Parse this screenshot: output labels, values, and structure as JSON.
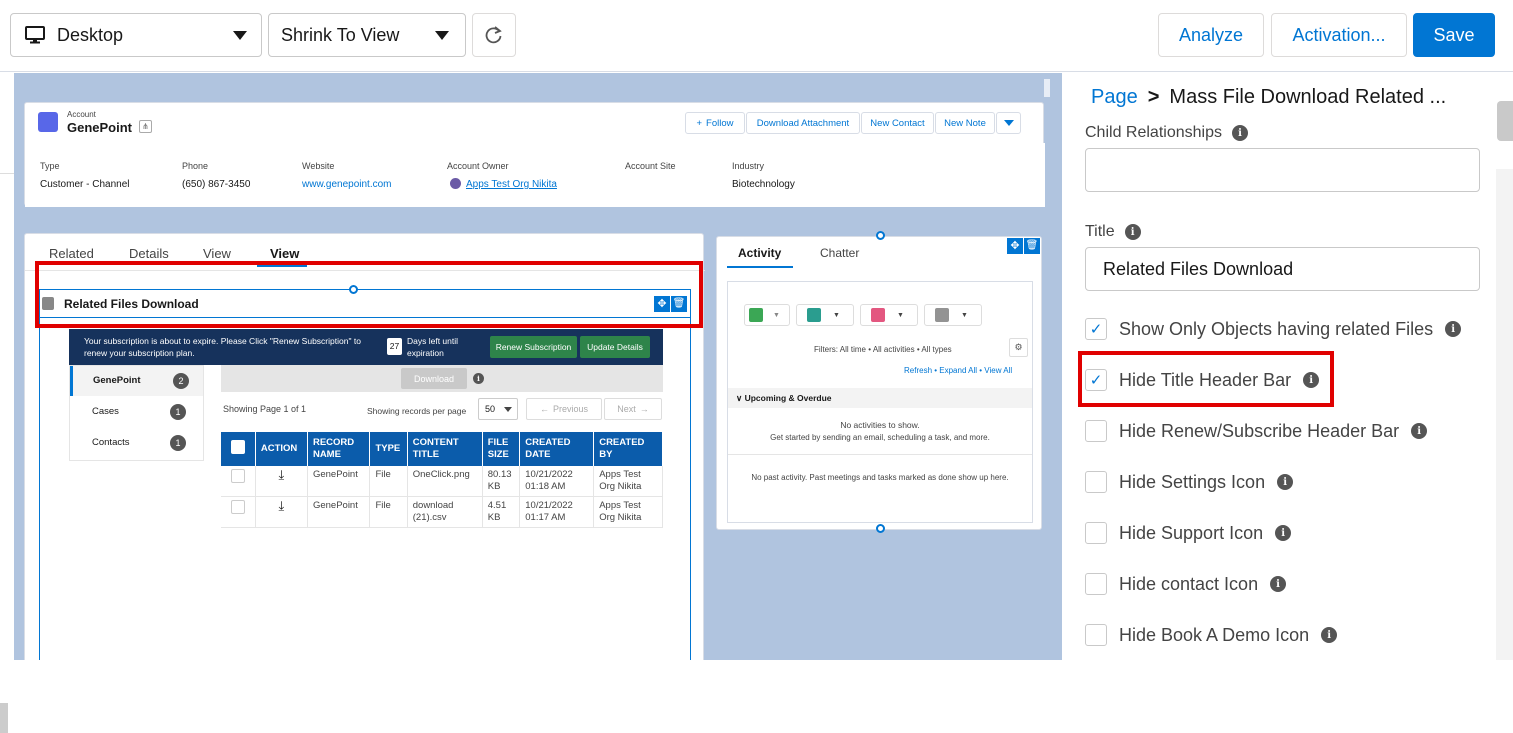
{
  "toolbar": {
    "device_label": "Desktop",
    "view_label": "Shrink To View",
    "analyze": "Analyze",
    "activation": "Activation...",
    "save": "Save"
  },
  "account": {
    "object_label": "Account",
    "name": "GenePoint",
    "buttons": [
      "Follow",
      "Download Attachment",
      "New Contact",
      "New Note"
    ],
    "fields": [
      {
        "label": "Type",
        "value": "Customer - Channel"
      },
      {
        "label": "Phone",
        "value": "(650) 867-3450"
      },
      {
        "label": "Website",
        "value": "www.genepoint.com"
      },
      {
        "label": "Account Owner",
        "value": "Apps Test Org Nikita"
      },
      {
        "label": "Account Site",
        "value": ""
      },
      {
        "label": "Industry",
        "value": "Biotechnology"
      }
    ]
  },
  "tabs": [
    "Related",
    "Details",
    "View",
    "View"
  ],
  "component": {
    "title": "Related Files Download",
    "banner_text": "Your subscription is about to expire. Please Click \"Renew Subscription\" to renew your subscription plan.",
    "days_left": "27",
    "days_text": "Days left until expiration",
    "renew_btn": "Renew Subscription",
    "update_btn": "Update Details",
    "objects": [
      {
        "name": "GenePoint",
        "count": "2"
      },
      {
        "name": "Cases",
        "count": "1"
      },
      {
        "name": "Contacts",
        "count": "1"
      }
    ],
    "download_btn": "Download",
    "showing_page": "Showing Page 1 of 1",
    "per_page_label": "Showing records per page",
    "per_page_value": "50",
    "prev": "Previous",
    "next": "Next",
    "columns": [
      "ACTION",
      "RECORD NAME",
      "TYPE",
      "CONTENT TITLE",
      "FILE SIZE",
      "CREATED DATE",
      "CREATED BY"
    ],
    "rows": [
      {
        "record": "GenePoint",
        "type": "File",
        "title": "OneClick.png",
        "size": "80.13 KB",
        "date": "10/21/2022 01:18 AM",
        "by": "Apps Test Org Nikita"
      },
      {
        "record": "GenePoint",
        "type": "File",
        "title": "download (21).csv",
        "size": "4.51 KB",
        "date": "10/21/2022 01:17 AM",
        "by": "Apps Test Org Nikita"
      }
    ]
  },
  "activity": {
    "tab_activity": "Activity",
    "tab_chatter": "Chatter",
    "filters": "Filters: All time • All activities • All types",
    "links": "Refresh • Expand All • View All",
    "upcoming": "Upcoming & Overdue",
    "no_act": "No activities to show.",
    "get_started": "Get started by sending an email, scheduling a task, and more.",
    "no_past": "No past activity. Past meetings and tasks marked as done show up here."
  },
  "panel": {
    "breadcrumb_page": "Page",
    "breadcrumb_sep": ">",
    "breadcrumb_current": "Mass File Download Related ...",
    "child_rel_label": "Child Relationships",
    "child_rel_value": "",
    "title_label": "Title",
    "title_value": "Related Files Download",
    "options": [
      {
        "label": "Show Only Objects having related Files",
        "checked": true
      },
      {
        "label": "Hide Title Header Bar",
        "checked": true
      },
      {
        "label": "Hide Renew/Subscribe Header Bar",
        "checked": false
      },
      {
        "label": "Hide Settings Icon",
        "checked": false
      },
      {
        "label": "Hide Support Icon",
        "checked": false
      },
      {
        "label": "Hide contact Icon",
        "checked": false
      },
      {
        "label": "Hide Book A Demo Icon",
        "checked": false
      }
    ]
  },
  "colors": {
    "brand": "#0176d3",
    "table_header": "#0b5cab",
    "banner": "#16325c",
    "green": "#2e844a",
    "highlight": "#e00000"
  }
}
